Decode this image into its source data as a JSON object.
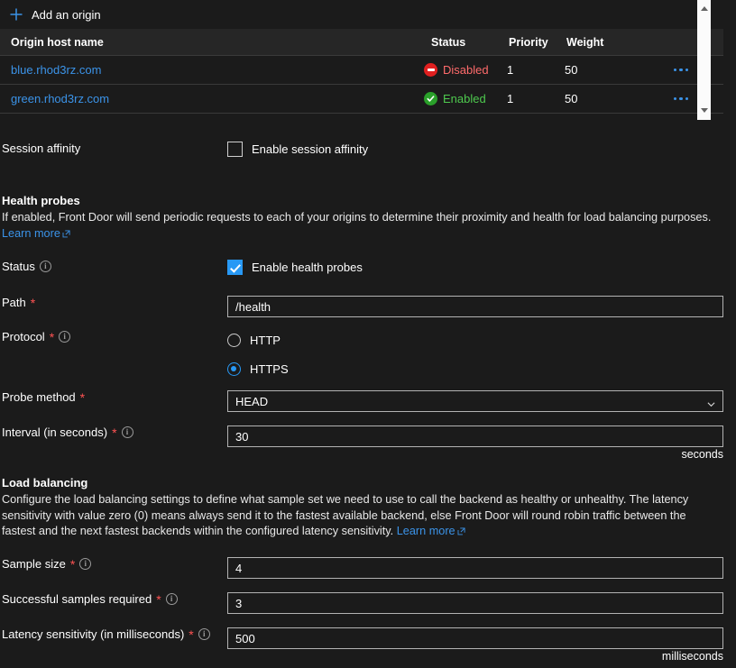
{
  "origins": {
    "add_label": "Add an origin",
    "add_icon": "plus-icon",
    "columns": [
      "Origin host name",
      "Status",
      "Priority",
      "Weight"
    ],
    "rows": [
      {
        "host": "blue.rhod3rz.com",
        "status": "Disabled",
        "status_icon": "error-circle-icon",
        "priority": "1",
        "weight": "50",
        "menu_icon": "ellipsis-icon"
      },
      {
        "host": "green.rhod3rz.com",
        "status": "Enabled",
        "status_icon": "check-circle-icon",
        "priority": "1",
        "weight": "50",
        "menu_icon": "ellipsis-icon"
      }
    ],
    "scrollbar": {
      "up_icon": "triangle-up-icon",
      "down_icon": "triangle-down-icon"
    }
  },
  "session_affinity": {
    "label": "Session affinity",
    "checkbox_label": "Enable session affinity",
    "checked": false
  },
  "health_probes": {
    "title": "Health probes",
    "description": "If enabled, Front Door will send periodic requests to each of your origins to determine their proximity and health for load balancing purposes.",
    "learn_more": "Learn more",
    "learn_more_icon": "external-link-icon",
    "status": {
      "label": "Status",
      "info_icon": "info-icon",
      "checkbox_label": "Enable health probes",
      "checked": true
    },
    "path": {
      "label": "Path",
      "required": "*",
      "value": "/health"
    },
    "protocol": {
      "label": "Protocol",
      "required": "*",
      "info_icon": "info-icon",
      "options": [
        "HTTP",
        "HTTPS"
      ],
      "selected": "HTTPS"
    },
    "probe_method": {
      "label": "Probe method",
      "required": "*",
      "value": "HEAD",
      "chevron_icon": "chevron-down-icon"
    },
    "interval": {
      "label": "Interval (in seconds)",
      "required": "*",
      "info_icon": "info-icon",
      "value": "30",
      "suffix": "seconds"
    }
  },
  "load_balancing": {
    "title": "Load balancing",
    "description": "Configure the load balancing settings to define what sample set we need to use to call the backend as healthy or unhealthy. The latency sensitivity with value zero (0) means always send it to the fastest available backend, else Front Door will round robin traffic between the fastest and the next fastest backends within the configured latency sensitivity.",
    "learn_more": "Learn more",
    "learn_more_icon": "external-link-icon",
    "sample_size": {
      "label": "Sample size",
      "required": "*",
      "info_icon": "info-icon",
      "value": "4"
    },
    "successful_samples": {
      "label": "Successful samples required",
      "required": "*",
      "info_icon": "info-icon",
      "value": "3"
    },
    "latency_sensitivity": {
      "label": "Latency sensitivity (in milliseconds)",
      "required": "*",
      "info_icon": "info-icon",
      "value": "500",
      "suffix": "milliseconds"
    }
  },
  "colors": {
    "accent": "#3b93e8",
    "checkbox_blue": "#2899f5",
    "enabled_green": "#4ec94e",
    "disabled_red": "#ff6b6b",
    "required_red": "#ff5252",
    "page_bg": "#1b1b1b"
  }
}
